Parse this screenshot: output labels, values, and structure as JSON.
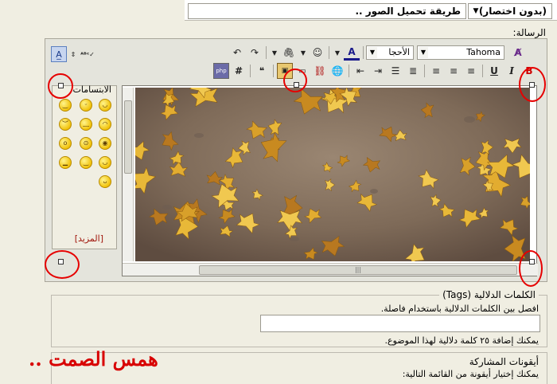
{
  "top": {
    "prefix": "(بدون اختصار)",
    "title_value": "طريقة تحميل الصور .."
  },
  "message_label": "الرسالة:",
  "toolbar": {
    "font_name": "Tahoma",
    "font_size": "الأحجا",
    "icons_row1": [
      "clear-format-icon",
      "text-color-icon",
      "smiley-icon",
      "attach-icon",
      "undo-icon",
      "redo-icon",
      "spellcheck-icon",
      "toggle-size-icon",
      "switch-mode-icon"
    ],
    "icons_row2": [
      "bold-icon",
      "italic-icon",
      "underline-icon",
      "align-right-icon",
      "align-center-icon",
      "align-left-icon",
      "numbered-list-icon",
      "bullet-list-icon",
      "outdent-icon",
      "indent-icon",
      "link-icon",
      "unlink-icon",
      "email-icon",
      "image-icon",
      "video-icon",
      "quote-icon",
      "hash-icon",
      "php-icon"
    ]
  },
  "smilies": {
    "title": "الابتسامات",
    "more_label": "[المزيد]"
  },
  "tags": {
    "title": "الكلمات الدلالية (Tags)",
    "hint": "افصل بين الكلمات الدلالية باستخدام فاصلة.",
    "limit": "يمكنك إضافة ٢٥ كلمة دلالية لهذا الموضوع."
  },
  "post_icons": {
    "title": "أيقونات المشاركة",
    "hint": "يمكنك إختيار أيقونة من القائمة التالية:"
  },
  "signature": "همس الصمت .."
}
